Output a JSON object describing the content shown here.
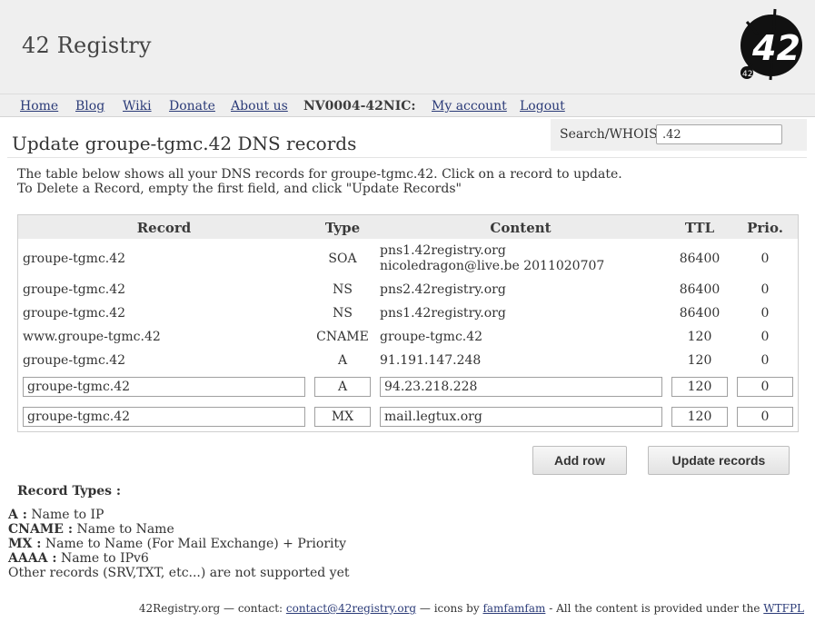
{
  "header": {
    "site_title": "42 Registry",
    "logo_icon": "42-registry-logo"
  },
  "nav": {
    "items": [
      {
        "label": "Home"
      },
      {
        "label": "Blog"
      },
      {
        "label": "Wiki"
      },
      {
        "label": "Donate"
      },
      {
        "label": "About us"
      }
    ],
    "handle": "NV0004-42NIC:",
    "account_items": [
      {
        "label": "My account"
      },
      {
        "label": "Logout"
      }
    ]
  },
  "page_title": "Update groupe-tgmc.42 DNS records",
  "search": {
    "label": "Search/WHOIS :",
    "value": ".42"
  },
  "intro": {
    "line1": "The table below shows all your DNS records for groupe-tgmc.42. Click on a record to update.",
    "line2": "To Delete a Record, empty the first field, and click \"Update Records\""
  },
  "table": {
    "columns": [
      "Record",
      "Type",
      "Content",
      "TTL",
      "Prio."
    ],
    "rows": [
      {
        "record": "groupe-tgmc.42",
        "type": "SOA",
        "content": "pns1.42registry.org nicoledragon@live.be 2011020707",
        "ttl": "86400",
        "prio": "0"
      },
      {
        "record": "groupe-tgmc.42",
        "type": "NS",
        "content": "pns2.42registry.org",
        "ttl": "86400",
        "prio": "0"
      },
      {
        "record": "groupe-tgmc.42",
        "type": "NS",
        "content": "pns1.42registry.org",
        "ttl": "86400",
        "prio": "0"
      },
      {
        "record": "www.groupe-tgmc.42",
        "type": "CNAME",
        "content": "groupe-tgmc.42",
        "ttl": "120",
        "prio": "0"
      },
      {
        "record": "groupe-tgmc.42",
        "type": "A",
        "content": "91.191.147.248",
        "ttl": "120",
        "prio": "0"
      }
    ],
    "editable_rows": [
      {
        "record": "groupe-tgmc.42",
        "type": "A",
        "content": "94.23.218.228",
        "ttl": "120",
        "prio": "0"
      },
      {
        "record": "groupe-tgmc.42",
        "type": "MX",
        "content": "mail.legtux.org",
        "ttl": "120",
        "prio": "0"
      }
    ]
  },
  "buttons": {
    "add_row": "Add row",
    "update_records": "Update records"
  },
  "record_types": {
    "heading": "Record Types :",
    "items": [
      {
        "key": "A :",
        "desc": " Name to IP"
      },
      {
        "key": "CNAME :",
        "desc": " Name to Name"
      },
      {
        "key": "MX :",
        "desc": " Name to Name (For Mail Exchange) + Priority"
      },
      {
        "key": "AAAA :",
        "desc": " Name to IPv6"
      }
    ],
    "note": "Other records (SRV,TXT, etc...) are not supported yet"
  },
  "footer": {
    "prefix": "42Registry.org — contact: ",
    "contact": "contact@42registry.org",
    "mid": " — icons by ",
    "icons_by": "famfamfam",
    "suffix": " - All the content is provided under the ",
    "license": "WTFPL"
  },
  "colors": {
    "link": "#2b3b78",
    "header_bg": "#efefef"
  }
}
